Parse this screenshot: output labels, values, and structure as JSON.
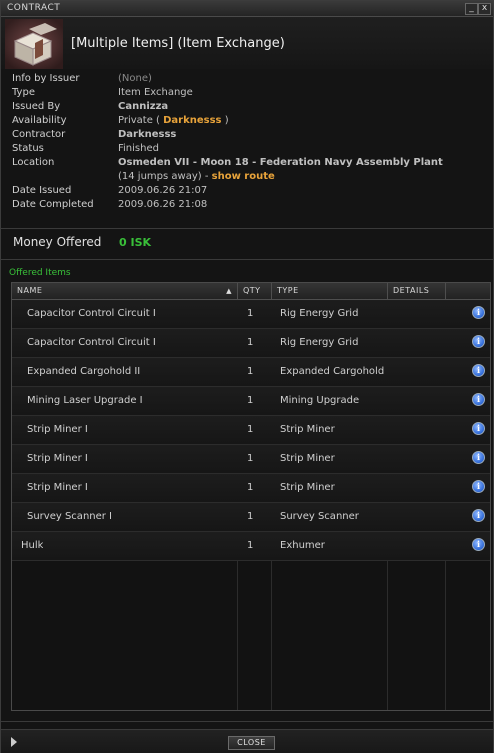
{
  "window": {
    "title": "CONTRACT",
    "min_btn": "_",
    "close_btn": "x"
  },
  "contract": {
    "name": "[Multiple Items] (Item Exchange)"
  },
  "info": {
    "info_by_issuer": {
      "label": "Info by Issuer",
      "value": "(None)"
    },
    "type": {
      "label": "Type",
      "value": "Item Exchange"
    },
    "issued_by": {
      "label": "Issued By",
      "value": "Cannizza"
    },
    "availability": {
      "label": "Availability",
      "prefix": "Private ( ",
      "name": "Darknesss",
      "suffix": " )"
    },
    "contractor": {
      "label": "Contractor",
      "value": "Darknesss"
    },
    "status": {
      "label": "Status",
      "value": "Finished"
    },
    "location": {
      "label": "Location",
      "value": "Osmeden VII - Moon 18 - Federation Navy Assembly Plant",
      "jumps": "(14 jumps away) - ",
      "route_link": "show route"
    },
    "date_issued": {
      "label": "Date Issued",
      "value": "2009.06.26 21:07"
    },
    "date_completed": {
      "label": "Date Completed",
      "value": "2009.06.26 21:08"
    }
  },
  "money": {
    "label": "Money Offered",
    "value": "0 ISK"
  },
  "offered_items": {
    "title": "Offered Items",
    "columns": {
      "name": "NAME",
      "qty": "QTY",
      "type": "TYPE",
      "details": "DETAILS"
    },
    "rows": [
      {
        "name": "Capacitor Control Circuit I",
        "qty": "1",
        "type": "Rig Energy Grid",
        "info": "i"
      },
      {
        "name": "Capacitor Control Circuit I",
        "qty": "1",
        "type": "Rig Energy Grid",
        "info": "i"
      },
      {
        "name": "Expanded Cargohold II",
        "qty": "1",
        "type": "Expanded Cargohold",
        "info": "i"
      },
      {
        "name": "Mining Laser Upgrade I",
        "qty": "1",
        "type": "Mining Upgrade",
        "info": "i"
      },
      {
        "name": "Strip Miner I",
        "qty": "1",
        "type": "Strip Miner",
        "info": "i"
      },
      {
        "name": "Strip Miner I",
        "qty": "1",
        "type": "Strip Miner",
        "info": "i"
      },
      {
        "name": "Strip Miner I",
        "qty": "1",
        "type": "Strip Miner",
        "info": "i"
      },
      {
        "name": "Survey Scanner I",
        "qty": "1",
        "type": "Survey Scanner",
        "info": "i"
      },
      {
        "name": "Hulk",
        "qty": "1",
        "type": "Exhumer",
        "info": "i"
      }
    ]
  },
  "footer": {
    "close_label": "CLOSE"
  },
  "colors": {
    "accent_orange": "#e8a33a",
    "accent_green": "#39c039",
    "info_icon_blue": "#2f6ad8"
  }
}
